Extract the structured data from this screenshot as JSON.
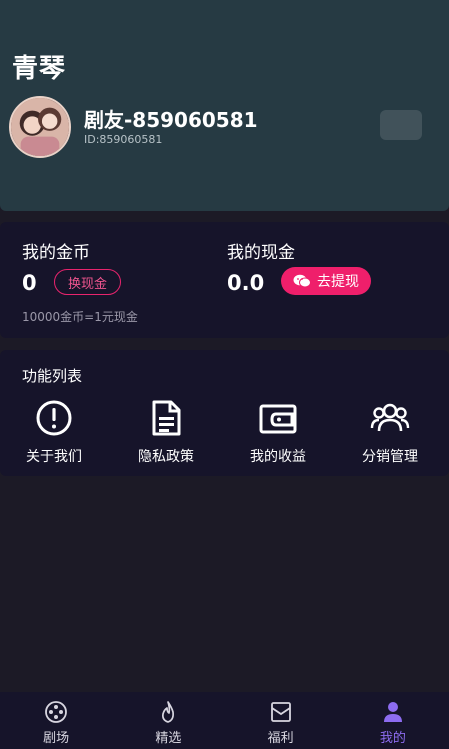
{
  "header": {
    "title": "青琴",
    "user_name": "剧友-859060581",
    "user_id": "ID:859060581"
  },
  "wallet": {
    "coins_label": "我的金币",
    "coins_value": "0",
    "exchange_button": "换现金",
    "cash_label": "我的现金",
    "cash_value": "0.0",
    "withdraw_button": "去提现",
    "rate_note": "10000金币=1元现金"
  },
  "features": {
    "title": "功能列表",
    "items": [
      {
        "label": "关于我们",
        "icon": "info-icon"
      },
      {
        "label": "隐私政策",
        "icon": "document-icon"
      },
      {
        "label": "我的收益",
        "icon": "wallet-icon"
      },
      {
        "label": "分销管理",
        "icon": "users-icon"
      }
    ]
  },
  "nav": {
    "items": [
      {
        "label": "剧场",
        "icon": "film-reel-icon"
      },
      {
        "label": "精选",
        "icon": "flame-icon"
      },
      {
        "label": "福利",
        "icon": "envelope-icon"
      },
      {
        "label": "我的",
        "icon": "person-icon",
        "active": true
      }
    ]
  },
  "colors": {
    "header_bg": "#263a43",
    "page_bg": "#1c1a26",
    "card_bg": "#16142a",
    "accent_pink": "#ef1f6b",
    "nav_active": "#8d6cf0"
  }
}
